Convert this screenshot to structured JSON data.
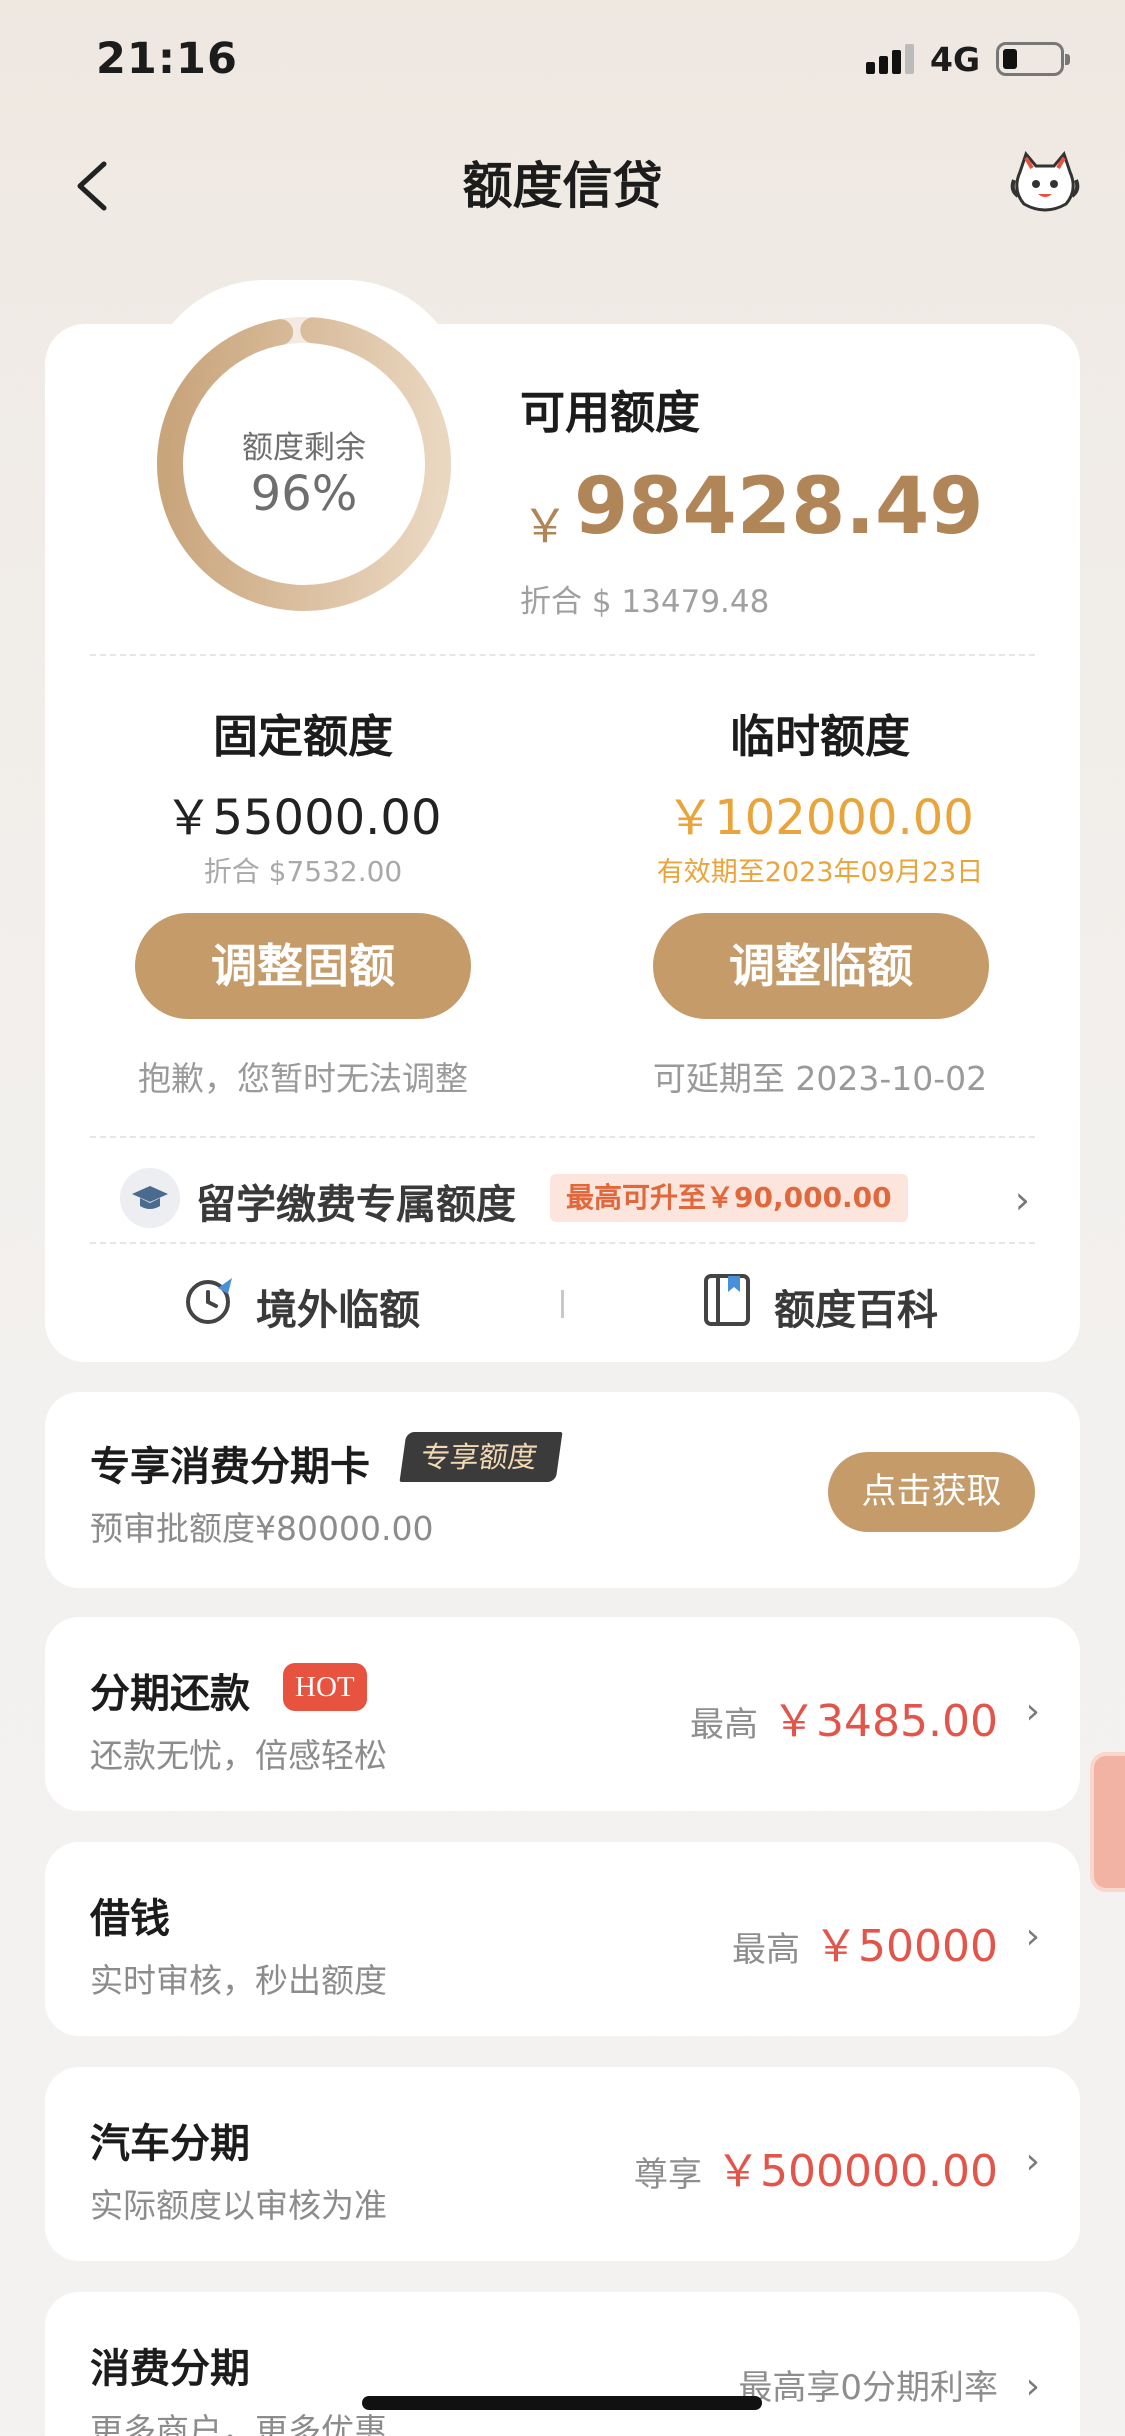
{
  "status_bar": {
    "time": "21:16",
    "network": "4G"
  },
  "nav": {
    "title": "额度信贷",
    "back_icon": "chevron-left-icon",
    "service_icon": "cat-mascot-icon"
  },
  "credit": {
    "ring_label": "额度剩余",
    "ring_value": "96%",
    "ring_fraction": 0.96,
    "available_label": "可用额度",
    "currency_symbol": "￥",
    "available_amount": "98428.49",
    "available_converted": "折合 $ 13479.48",
    "fixed": {
      "title": "固定额度",
      "amount": "￥55000.00",
      "sub": "折合 $7532.00",
      "button": "调整固额",
      "note": "抱歉，您暂时无法调整"
    },
    "temporary": {
      "title": "临时额度",
      "amount": "￥102000.00",
      "sub": "有效期至2023年09月23日",
      "button": "调整临额",
      "note": "可延期至 2023-10-02"
    },
    "study": {
      "icon": "graduation-cap-icon",
      "label": "留学缴费专属额度",
      "tag": "最高可升至￥90,000.00"
    },
    "tools": [
      {
        "icon": "plane-clock-icon",
        "label": "境外临额"
      },
      {
        "icon": "book-icon",
        "label": "额度百科"
      }
    ]
  },
  "promo": {
    "title": "专享消费分期卡",
    "tag": "专享额度",
    "sub": "预审批额度¥80000.00",
    "button": "点击获取"
  },
  "products": [
    {
      "title": "分期还款",
      "badge": "HOT",
      "sub": "还款无忧，倍感轻松",
      "prefix": "最高",
      "amount": "￥3485.00"
    },
    {
      "title": "借钱",
      "sub": "实时审核，秒出额度",
      "prefix": "最高",
      "amount": "￥50000"
    },
    {
      "title": "汽车分期",
      "sub": "实际额度以审核为准",
      "prefix": "尊享",
      "amount": "￥500000.00"
    },
    {
      "title": "消费分期",
      "sub": "更多商户，更多优惠",
      "prefix": "最高享0分期利率",
      "amount": ""
    }
  ],
  "colors": {
    "accent": "#c59b69",
    "gold_text": "#b08659",
    "temp_orange": "#e9a53b",
    "price_red": "#e2554b"
  }
}
